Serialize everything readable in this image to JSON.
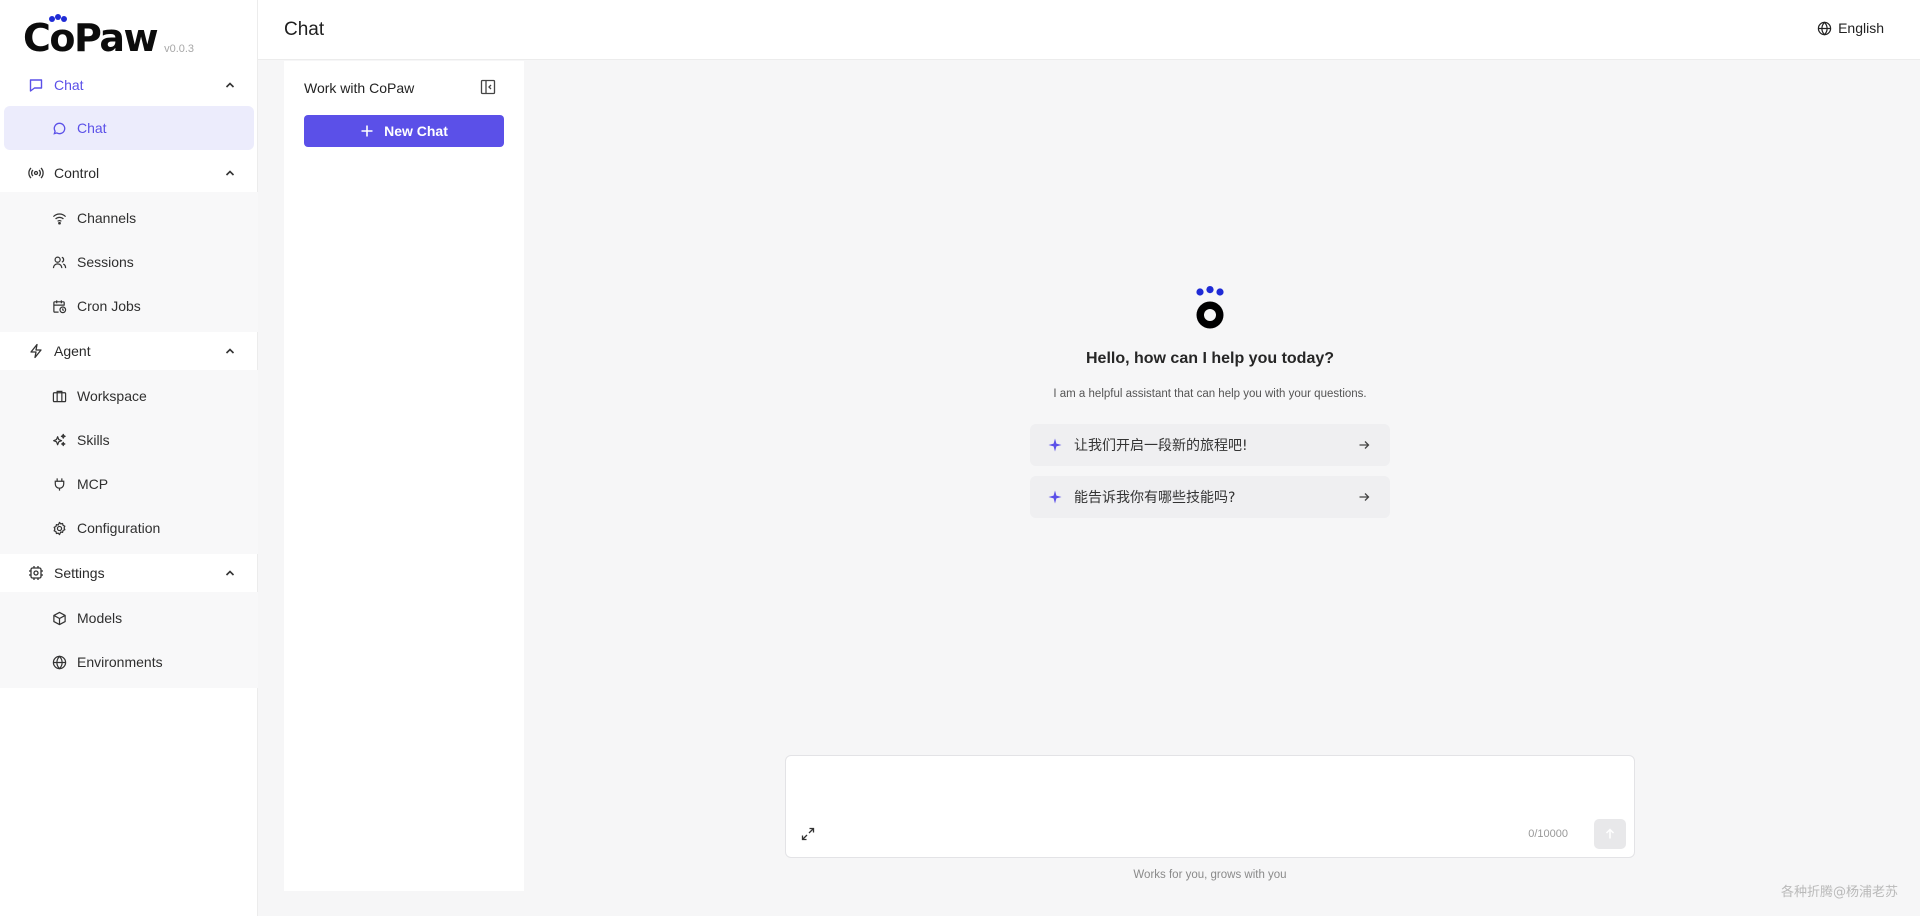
{
  "app": {
    "logo_text": "CoPaw",
    "version": "v0.0.3"
  },
  "header": {
    "title": "Chat",
    "language": "English"
  },
  "sidebar": {
    "groups": [
      {
        "label": "Chat",
        "items": [
          {
            "label": "Chat"
          }
        ]
      },
      {
        "label": "Control",
        "items": [
          {
            "label": "Channels"
          },
          {
            "label": "Sessions"
          },
          {
            "label": "Cron Jobs"
          }
        ]
      },
      {
        "label": "Agent",
        "items": [
          {
            "label": "Workspace"
          },
          {
            "label": "Skills"
          },
          {
            "label": "MCP"
          },
          {
            "label": "Configuration"
          }
        ]
      },
      {
        "label": "Settings",
        "items": [
          {
            "label": "Models"
          },
          {
            "label": "Environments"
          }
        ]
      }
    ]
  },
  "chat_list": {
    "title": "Work with CoPaw",
    "new_chat_label": "New Chat"
  },
  "welcome": {
    "title": "Hello, how can I help you today?",
    "subtitle": "I am a helpful assistant that can help you with your questions.",
    "prompts": [
      "让我们开启一段新的旅程吧!",
      "能告诉我你有哪些技能吗?"
    ]
  },
  "composer": {
    "counter": "0/10000",
    "placeholder": ""
  },
  "footer": {
    "tagline": "Works for you, grows with you",
    "watermark": "各种折腾@杨浦老苏"
  },
  "colors": {
    "accent": "#5b50e8",
    "logo_dots": "#1f2bd6"
  }
}
